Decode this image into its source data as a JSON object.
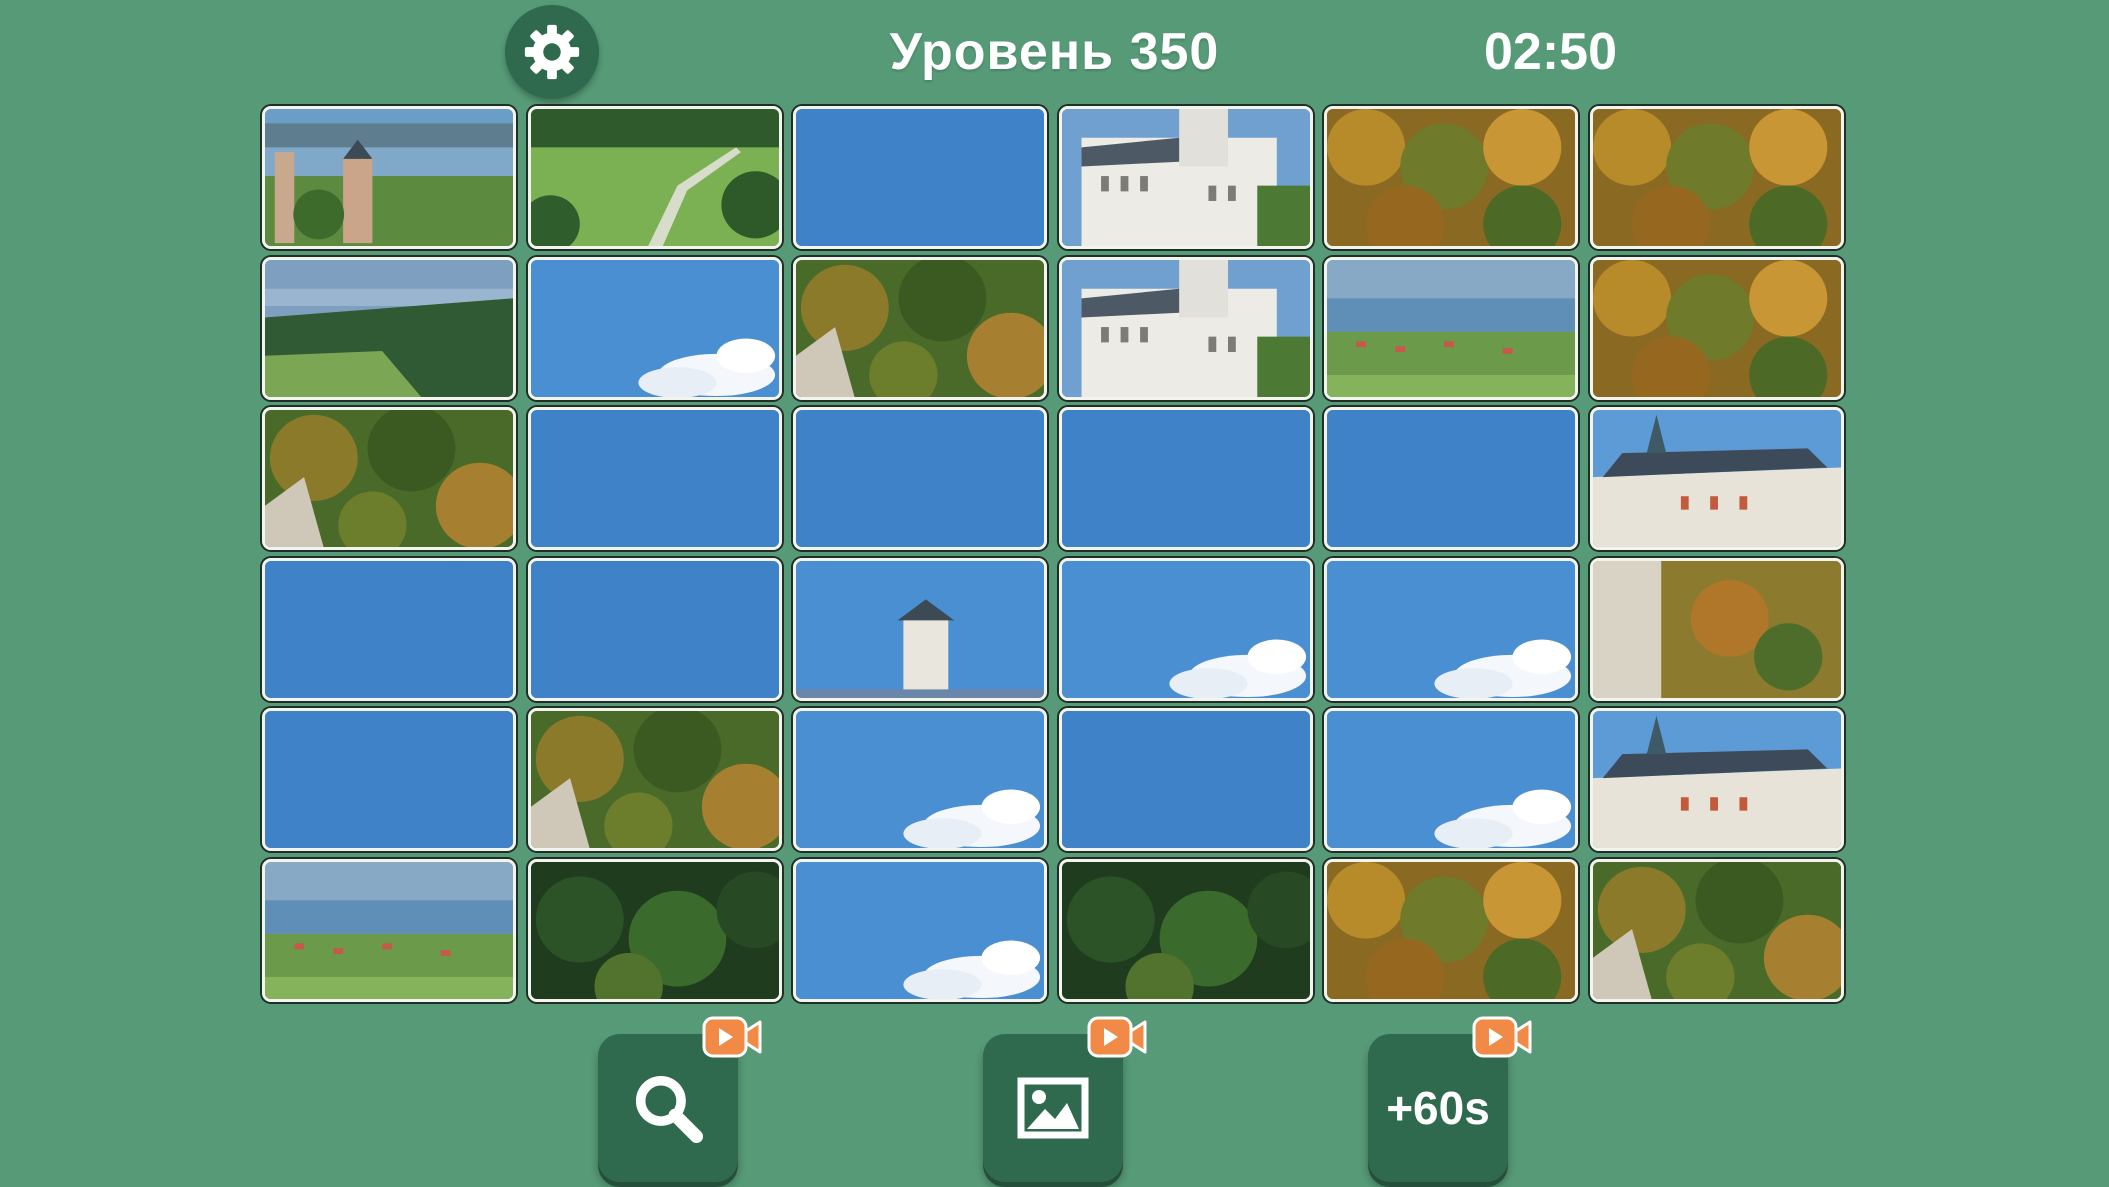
{
  "header": {
    "level_label": "Уровень 350",
    "timer": "02:50"
  },
  "settings_icon": "gear-icon",
  "board": {
    "rows": 6,
    "cols": 6,
    "tiles": [
      [
        "castle-lake",
        "meadow-path",
        "sky",
        "castle-front",
        "autumn-forest",
        "autumn-forest"
      ],
      [
        "lake-hills",
        "sky-cloud",
        "forest-cliff",
        "castle-front",
        "lake-village",
        "autumn-forest"
      ],
      [
        "forest-cliff",
        "sky",
        "sky",
        "sky",
        "sky",
        "castle-roof"
      ],
      [
        "sky",
        "sky",
        "sky-tower",
        "sky-cloud",
        "sky-cloud",
        "castle-cliff"
      ],
      [
        "sky",
        "forest-cliff",
        "sky-cloud",
        "sky",
        "sky-cloud",
        "castle-roof"
      ],
      [
        "lake-village",
        "dark-forest",
        "sky-cloud",
        "dark-forest",
        "autumn-forest",
        "forest-cliff"
      ]
    ]
  },
  "buttons": {
    "zoom": {
      "icon": "search-icon",
      "badge_icon": "video-ad-icon"
    },
    "preview": {
      "icon": "image-icon",
      "badge_icon": "video-ad-icon"
    },
    "time": {
      "label": "+60s",
      "badge_icon": "video-ad-icon"
    }
  },
  "colors": {
    "background": "#569a77",
    "button": "#2f6a4e",
    "sky": "#3f82c8",
    "badge": "#f08a46"
  }
}
